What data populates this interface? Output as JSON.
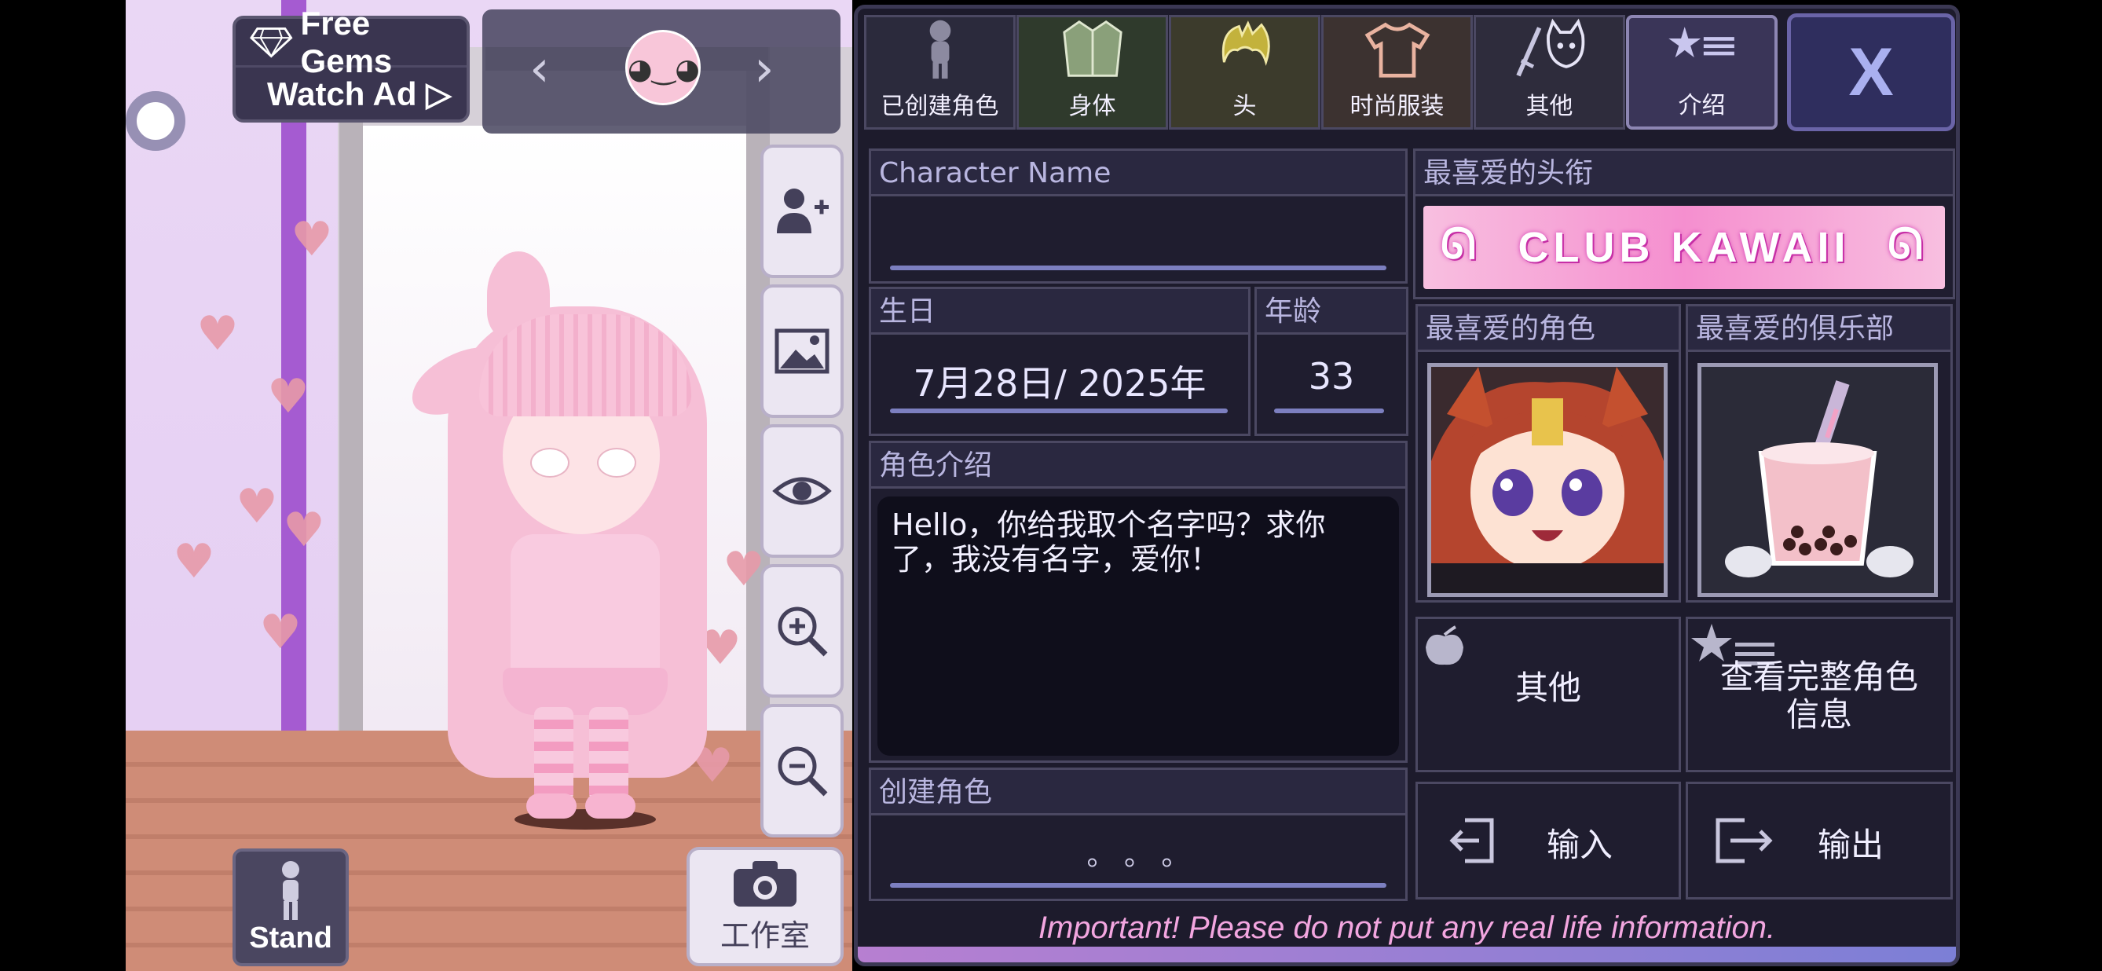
{
  "top_left": {
    "free_gems": "Free Gems",
    "watch_ad": "Watch Ad ▷"
  },
  "stand_label": "Stand",
  "studio_label": "工作室",
  "tabs": [
    {
      "label": "已创建角色",
      "icon": "character-silhouette-icon"
    },
    {
      "label": "身体",
      "icon": "jacket-icon"
    },
    {
      "label": "头",
      "icon": "hair-icon"
    },
    {
      "label": "时尚服装",
      "icon": "tshirt-icon"
    },
    {
      "label": "其他",
      "icon": "sword-cat-icon"
    },
    {
      "label": "介绍",
      "icon": "star-list-icon"
    }
  ],
  "close_label": "X",
  "profile": {
    "name_label": "Character Name",
    "name_value": "",
    "birthday_label": "生日",
    "birthday_value": "7月28日/ 2025年",
    "age_label": "年龄",
    "age_value": "33",
    "bio_label": "角色介绍",
    "bio_value": "Hello，你给我取个名字吗？求你了，我没有名字，爱你！",
    "created_label": "创建角色",
    "created_value": "。 。 。",
    "fav_title_label": "最喜爱的头衔",
    "fav_title_banner": "CLUB KAWAII",
    "fav_char_label": "最喜爱的角色",
    "fav_club_label": "最喜爱的俱乐部",
    "other_label": "其他",
    "full_info_label": "查看完整角色信息",
    "import_label": "输入",
    "export_label": "输出"
  },
  "warning": "Important! Please do not put any real life information.",
  "colors": {
    "panel_bg": "#1d1b2c",
    "accent": "#7c7fc0",
    "warning": "#f3a6e0",
    "scene_wall": "#e4cdf2"
  }
}
